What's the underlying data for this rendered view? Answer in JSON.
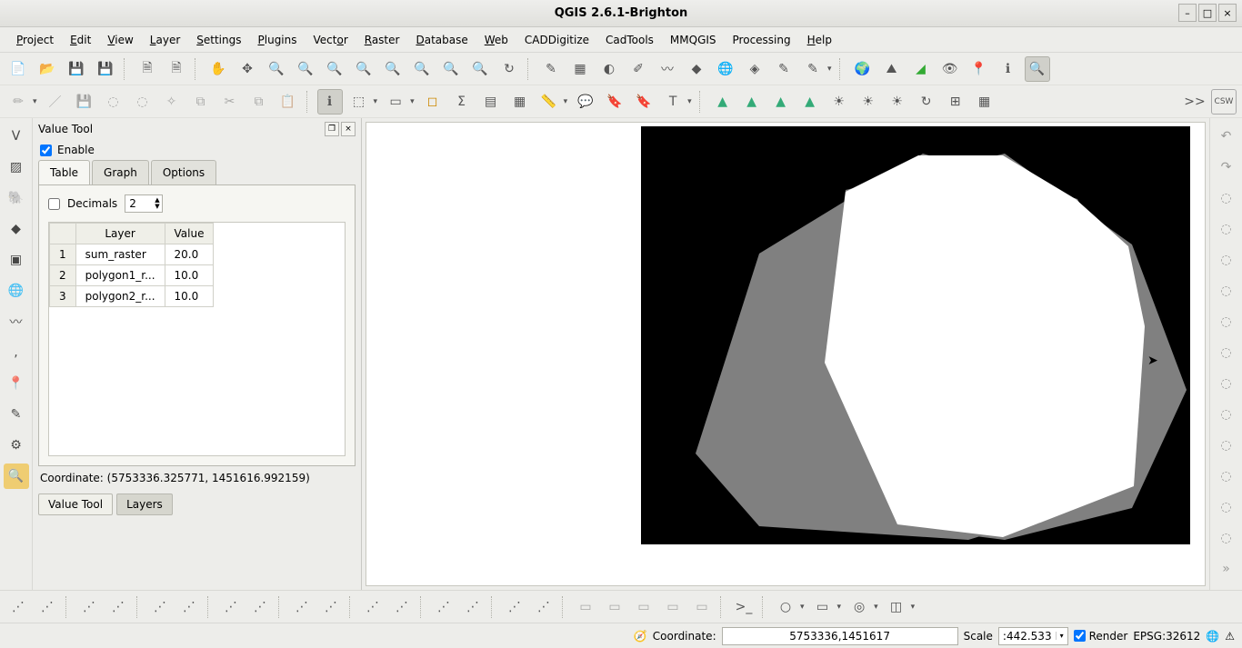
{
  "window": {
    "title": "QGIS 2.6.1-Brighton"
  },
  "menu": [
    "Project",
    "Edit",
    "View",
    "Layer",
    "Settings",
    "Plugins",
    "Vector",
    "Raster",
    "Database",
    "Web",
    "CADDigitize",
    "CadTools",
    "MMQGIS",
    "Processing",
    "Help"
  ],
  "panel": {
    "title": "Value Tool",
    "enable_label": "Enable",
    "enable_checked": true,
    "tabs": {
      "table": "Table",
      "graph": "Graph",
      "options": "Options",
      "active": "table"
    },
    "decimals_label": "Decimals",
    "decimals_checked": false,
    "decimals_value": "2",
    "table": {
      "headers": {
        "layer": "Layer",
        "value": "Value"
      },
      "rows": [
        {
          "n": "1",
          "layer": "sum_raster",
          "value": "20.0"
        },
        {
          "n": "2",
          "layer": "polygon1_r...",
          "value": "10.0"
        },
        {
          "n": "3",
          "layer": "polygon2_r...",
          "value": "10.0"
        }
      ]
    },
    "coordinate_line": "Coordinate: (5753336.325771, 1451616.992159)",
    "bottom_tabs": {
      "value_tool": "Value Tool",
      "layers": "Layers",
      "active": "value_tool"
    }
  },
  "statusbar": {
    "coordinate_label": "Coordinate:",
    "coordinate_value": "5753336,1451617",
    "scale_label": "Scale",
    "scale_value": ":442.533",
    "render_label": "Render",
    "render_checked": true,
    "crs": "EPSG:32612"
  },
  "misc": {
    "expand": ">>",
    "csw": "CSW"
  }
}
